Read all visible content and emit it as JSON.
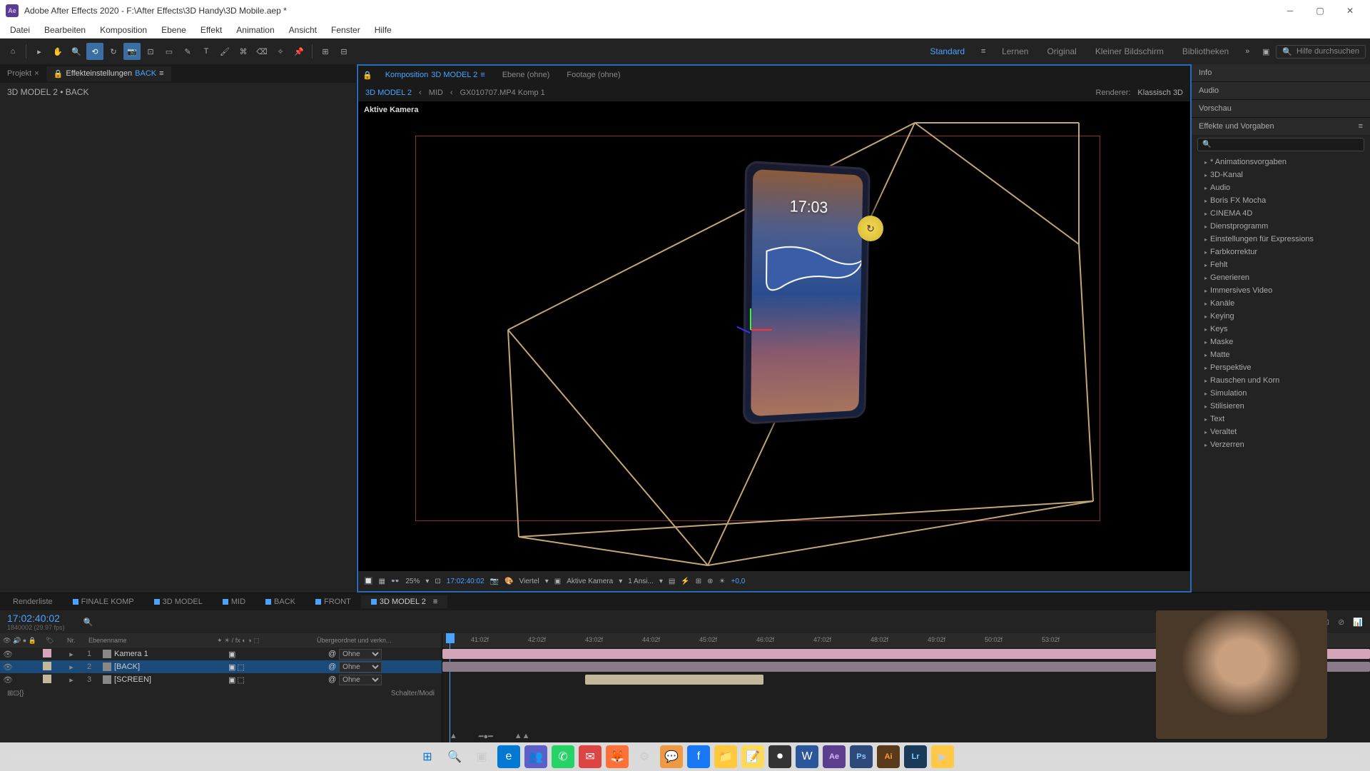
{
  "titlebar": {
    "app_icon": "Ae",
    "title": "Adobe After Effects 2020 - F:\\After Effects\\3D Handy\\3D Mobile.aep *"
  },
  "menu": [
    "Datei",
    "Bearbeiten",
    "Komposition",
    "Ebene",
    "Effekt",
    "Animation",
    "Ansicht",
    "Fenster",
    "Hilfe"
  ],
  "workspaces": [
    "Standard",
    "Lernen",
    "Original",
    "Kleiner Bildschirm",
    "Bibliotheken"
  ],
  "search_placeholder": "Hilfe durchsuchen",
  "left_panel": {
    "tab_project": "Projekt",
    "tab_effect": "Effekteinstellungen",
    "effect_target": "BACK",
    "breadcrumb": "3D MODEL 2 • BACK"
  },
  "comp": {
    "tab_label": "Komposition",
    "tab_name": "3D MODEL 2",
    "tab_layer": "Ebene (ohne)",
    "tab_footage": "Footage (ohne)",
    "nav_current": "3D MODEL 2",
    "nav_mid": "MID",
    "nav_clip": "GX010707.MP4 Komp 1",
    "renderer_label": "Renderer:",
    "renderer_value": "Klassisch 3D",
    "viewport_label": "Aktive Kamera",
    "phone_time": "17:03",
    "footer": {
      "zoom": "25%",
      "timecode": "17:02:40:02",
      "quality": "Viertel",
      "camera": "Aktive Kamera",
      "views": "1 Ansi...",
      "exposure": "+0,0"
    }
  },
  "right": {
    "info": "Info",
    "audio": "Audio",
    "preview": "Vorschau",
    "effects_title": "Effekte und Vorgaben",
    "effects": [
      "* Animationsvorgaben",
      "3D-Kanal",
      "Audio",
      "Boris FX Mocha",
      "CINEMA 4D",
      "Dienstprogramm",
      "Einstellungen für Expressions",
      "Farbkorrektur",
      "Fehlt",
      "Generieren",
      "Immersives Video",
      "Kanäle",
      "Keying",
      "Keys",
      "Maske",
      "Matte",
      "Perspektive",
      "Rauschen und Korn",
      "Simulation",
      "Stilisieren",
      "Text",
      "Veraltet",
      "Verzerren"
    ]
  },
  "timeline": {
    "tabs": [
      "Renderliste",
      "FINALE KOMP",
      "3D MODEL",
      "MID",
      "BACK",
      "FRONT",
      "3D MODEL 2"
    ],
    "active_tab": 6,
    "current_time": "17:02:40:02",
    "current_frames": "1840002 (29.97 fps)",
    "header_name": "Ebenenname",
    "header_parent": "Übergeordnet und verkn...",
    "parent_none": "Ohne",
    "footer_mode": "Schalter/Modi",
    "ruler_ticks": [
      "41:02f",
      "42:02f",
      "43:02f",
      "44:02f",
      "45:02f",
      "46:02f",
      "47:02f",
      "48:02f",
      "49:02f",
      "50:02f",
      "53:02f"
    ],
    "layers": [
      {
        "num": 1,
        "name": "Kamera 1",
        "type": "camera"
      },
      {
        "num": 2,
        "name": "[BACK]",
        "type": "comp",
        "selected": true
      },
      {
        "num": 3,
        "name": "[SCREEN]",
        "type": "comp"
      }
    ]
  },
  "taskbar_apps": [
    "windows",
    "search",
    "tasks",
    "edge",
    "teams",
    "whatsapp",
    "mail",
    "firefox",
    "app1",
    "messenger",
    "facebook",
    "explorer",
    "notes",
    "obs",
    "word",
    "ae",
    "ps",
    "ai",
    "lr"
  ]
}
